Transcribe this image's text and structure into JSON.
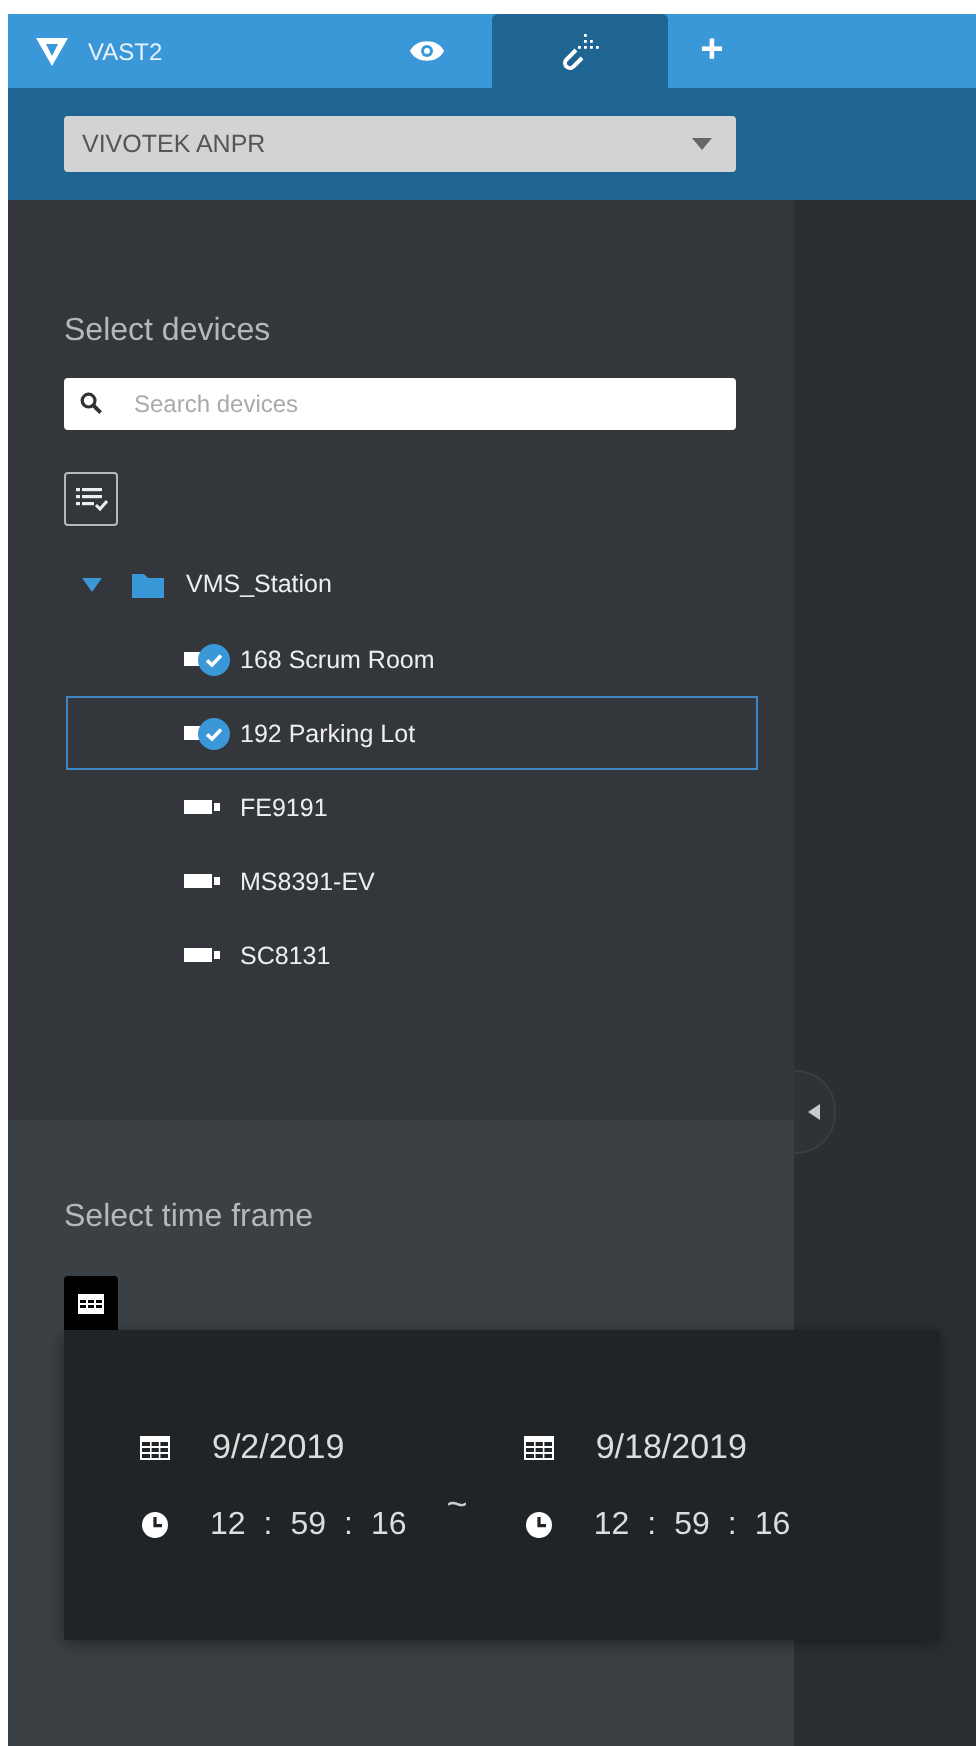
{
  "header": {
    "logo_text": "VAST2",
    "tabs": [
      {
        "kind": "eye",
        "selected": false
      },
      {
        "kind": "link",
        "selected": true
      },
      {
        "kind": "plus",
        "label": "+",
        "selected": false
      }
    ]
  },
  "site_dropdown": {
    "value": "VIVOTEK ANPR"
  },
  "devices": {
    "title": "Select devices",
    "search": {
      "placeholder": "Search devices"
    },
    "tree": [
      {
        "label": "VMS_Station",
        "kind": "folder",
        "expanded": true,
        "children": [
          {
            "label": "168 Scrum Room",
            "kind": "camera",
            "checked": true,
            "selected": false
          },
          {
            "label": "192 Parking Lot",
            "kind": "camera",
            "checked": true,
            "selected": true
          },
          {
            "label": "FE9191",
            "kind": "camera",
            "checked": false,
            "selected": false
          },
          {
            "label": "MS8391-EV",
            "kind": "camera",
            "checked": false,
            "selected": false
          },
          {
            "label": "SC8131",
            "kind": "camera",
            "checked": false,
            "selected": false
          }
        ]
      }
    ]
  },
  "time_frame": {
    "title": "Select time frame",
    "separator": "~",
    "start": {
      "date": "9/2/2019",
      "time": [
        "12",
        ":",
        "59",
        ":",
        "16"
      ]
    },
    "end": {
      "date": "9/18/2019",
      "time": [
        "12",
        ":",
        "59",
        ":",
        "16"
      ]
    }
  }
}
